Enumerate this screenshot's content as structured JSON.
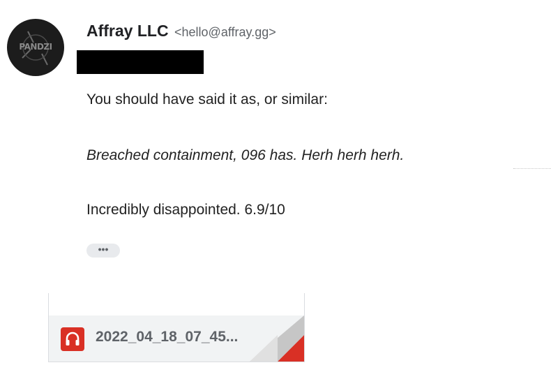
{
  "sender": {
    "name": "Affray LLC",
    "email": "<hello@affray.gg>",
    "avatar_text": "PANDZI"
  },
  "message": {
    "line1": "You should have said it as, or similar:",
    "line2": "Breached containment, 096 has.  Herh herh herh.",
    "line3": "Incredibly disappointed. 6.9/10",
    "more_label": "•••"
  },
  "attachment": {
    "filename": "2022_04_18_07_45...",
    "icon": "headphones-icon",
    "icon_color": "#d93025"
  },
  "colors": {
    "text": "#202124",
    "secondary": "#5f6368",
    "redaction": "#000000",
    "accent": "#d93025"
  }
}
